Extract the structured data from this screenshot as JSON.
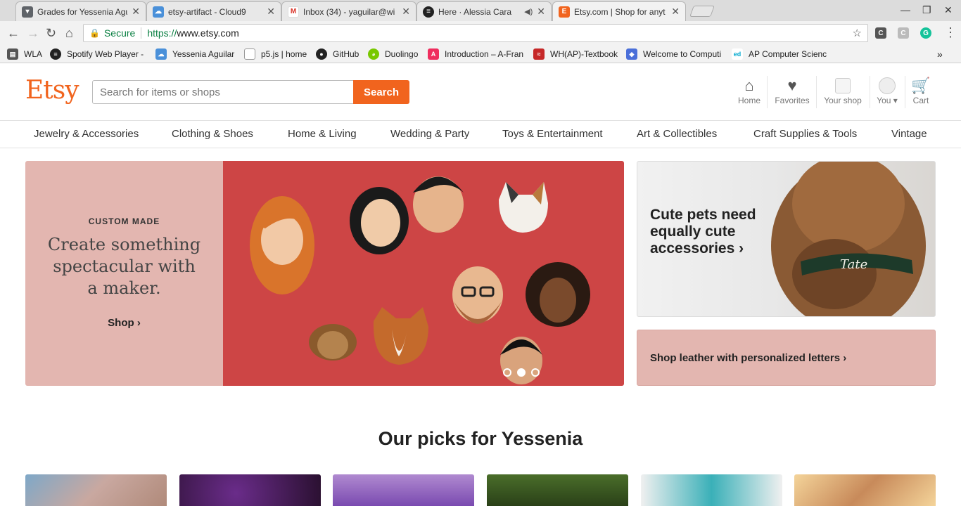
{
  "browser": {
    "tabs": [
      {
        "title": "Grades for Yessenia Agu",
        "favicon_color": "#5f6368"
      },
      {
        "title": "etsy-artifact - Cloud9",
        "favicon_color": "#4a90d9"
      },
      {
        "title": "Inbox (34) - yaguilar@wi",
        "favicon_color": "#d93025"
      },
      {
        "title": "Here · Alessia Cara",
        "favicon_color": "#222222"
      },
      {
        "title": "Etsy.com | Shop for anyt",
        "favicon_color": "#f1641e"
      }
    ],
    "address": {
      "secure_label": "Secure",
      "scheme": "https://",
      "host": "www.etsy.com"
    },
    "bookmarks": [
      "WLA",
      "Spotify Web Player -",
      "Yessenia Aguilar",
      "p5.js | home",
      "GitHub",
      "Duolingo",
      "Introduction – A-Fran",
      "WH(AP)-Textbook",
      "Welcome to Computi",
      "AP Computer Scienc"
    ],
    "bookmarks_overflow": "»"
  },
  "etsy": {
    "logo": "Etsy",
    "search_placeholder": "Search for items or shops",
    "search_button": "Search",
    "header_nav": [
      "Home",
      "Favorites",
      "Your shop",
      "You",
      "Cart"
    ],
    "categories": [
      "Jewelry & Accessories",
      "Clothing & Shoes",
      "Home & Living",
      "Wedding & Party",
      "Toys & Entertainment",
      "Art & Collectibles",
      "Craft Supplies & Tools",
      "Vintage"
    ],
    "hero": {
      "kicker": "CUSTOM MADE",
      "headline": "Create something spectacular with a maker.",
      "cta": "Shop ›",
      "carousel_dots": 3,
      "active_dot": 2
    },
    "promo_pets": {
      "title": "Cute pets need equally cute accessories ›",
      "collar_text": "Tate"
    },
    "promo_leather": {
      "title": "Shop leather with personalized letters ›"
    },
    "picks_heading": "Our picks for Yessenia",
    "accent": "#f1641e"
  }
}
